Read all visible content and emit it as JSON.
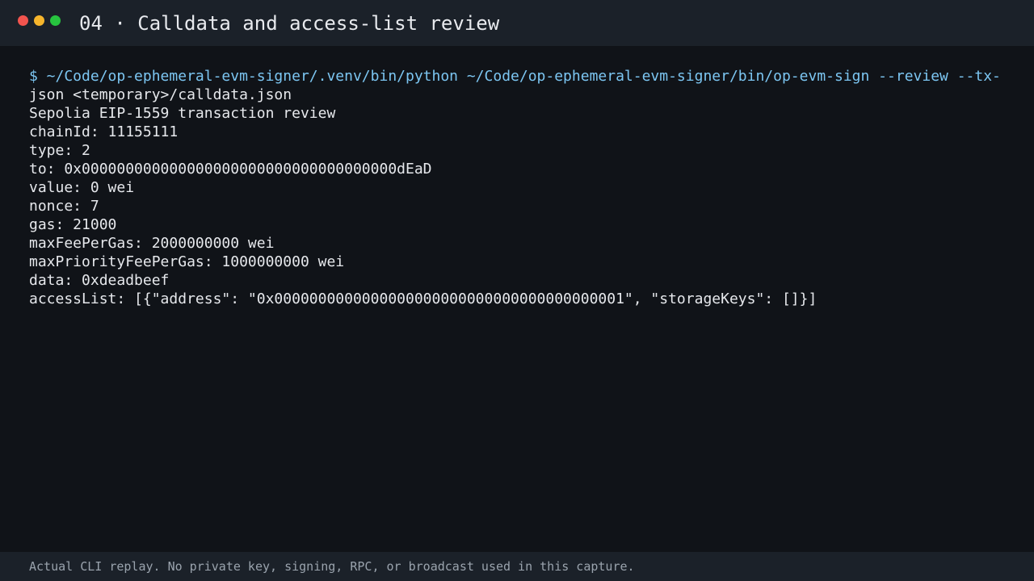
{
  "window": {
    "title": "04 · Calldata and access-list review"
  },
  "terminal": {
    "command_line_1": "$ ~/Code/op-ephemeral-evm-signer/.venv/bin/python ~/Code/op-ephemeral-evm-signer/bin/op-evm-sign --review --tx-",
    "command_line_2": "json <temporary>/calldata.json",
    "output": [
      "Sepolia EIP-1559 transaction review",
      "chainId: 11155111",
      "type: 2",
      "to: 0x000000000000000000000000000000000000dEaD",
      "value: 0 wei",
      "nonce: 7",
      "gas: 21000",
      "maxFeePerGas: 2000000000 wei",
      "maxPriorityFeePerGas: 1000000000 wei",
      "data: 0xdeadbeef",
      "accessList: [{\"address\": \"0x0000000000000000000000000000000000000001\", \"storageKeys\": []}]"
    ]
  },
  "footer": {
    "note": "Actual CLI replay. No private key, signing, RPC, or broadcast used in this capture."
  },
  "colors": {
    "background": "#101318",
    "titlebar": "#1b2129",
    "command": "#7cc6f2",
    "text": "#e6e8ec",
    "footer_text": "#9aa3ad",
    "close": "#f2544e",
    "minimize": "#f6b52c",
    "maximize": "#27c43f"
  }
}
